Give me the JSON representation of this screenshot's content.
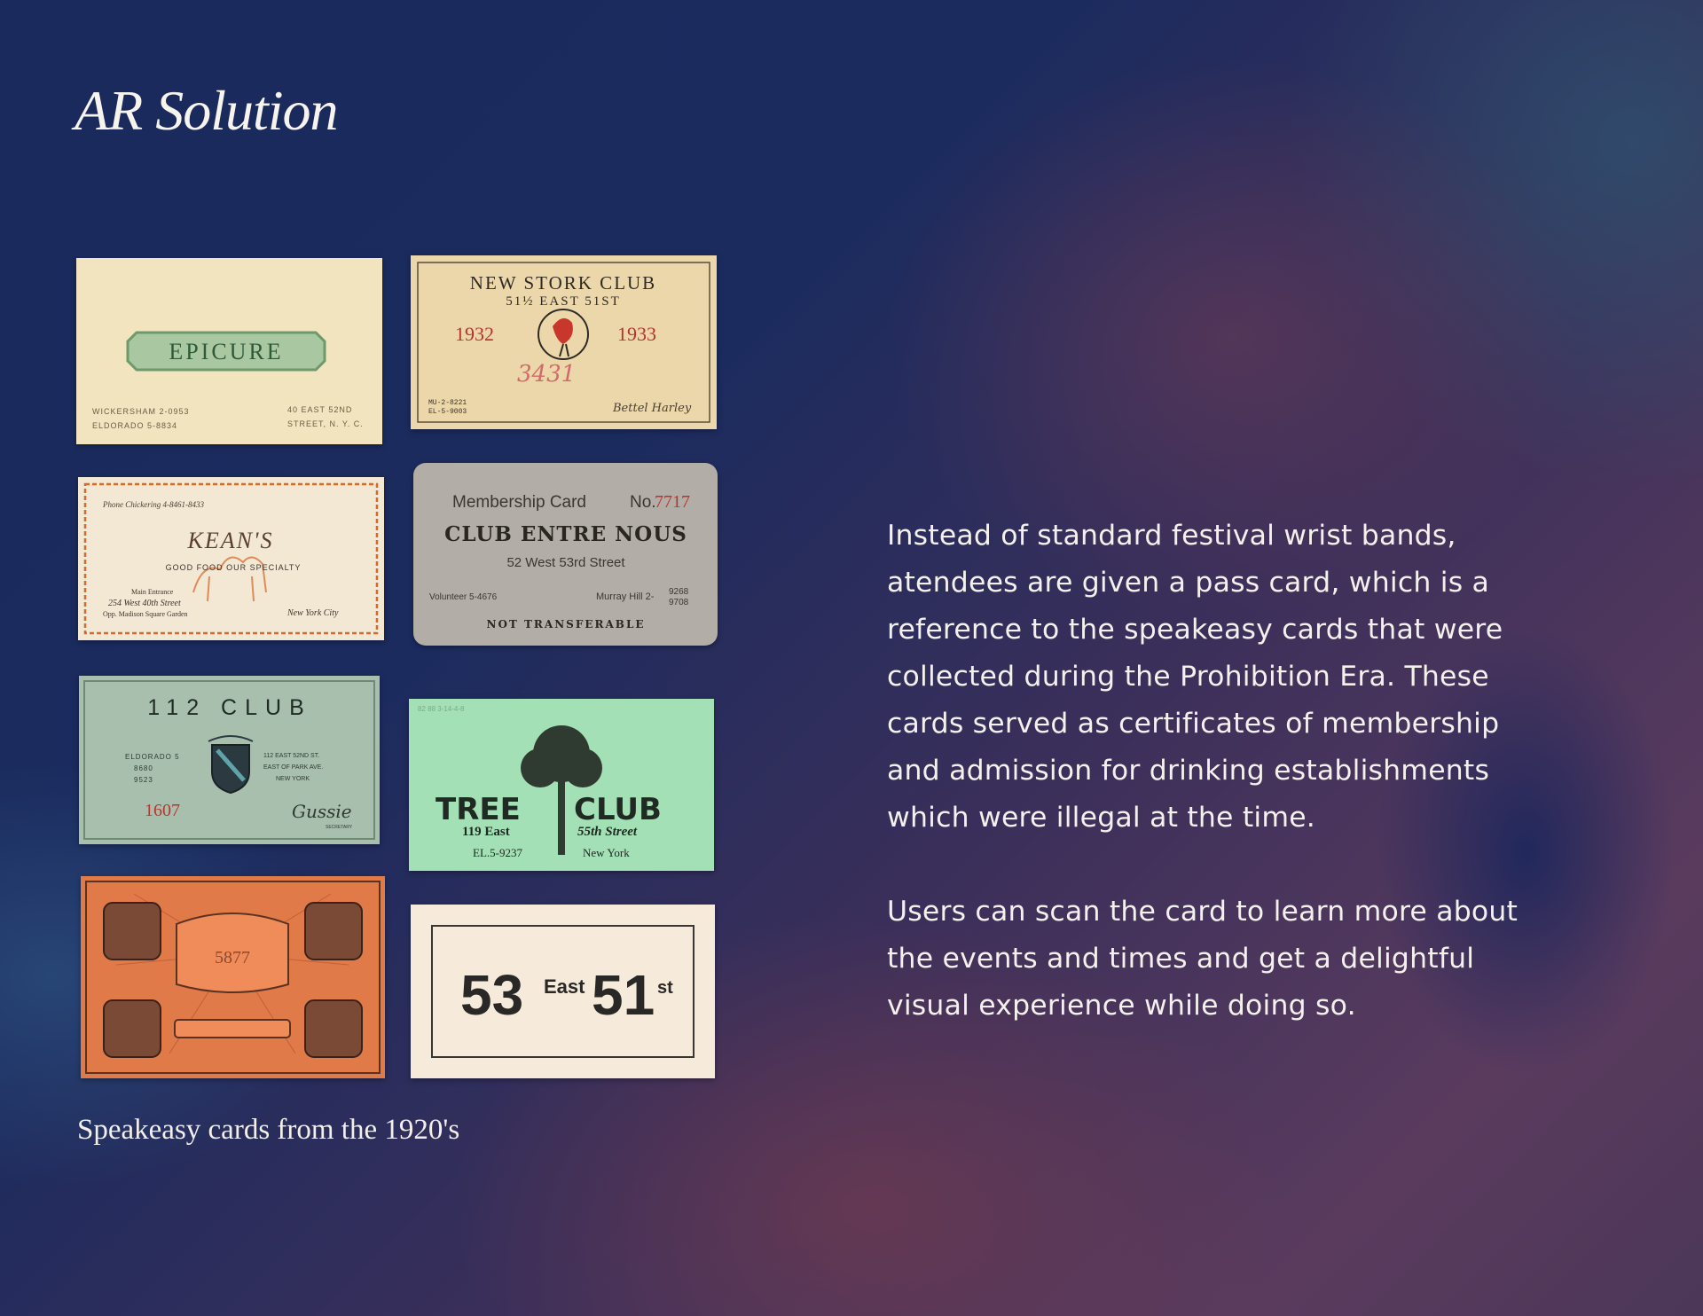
{
  "page": {
    "title": "AR Solution",
    "caption": "Speakeasy cards from the 1920's"
  },
  "description": {
    "paragraph1": [
      "Instead of standard festival wrist bands,",
      "atendees are given a pass card, which is a",
      "reference to the speakeasy cards that were",
      "collected during the Prohibition Era. These",
      "cards served as certificates of membership",
      "and admission for drinking establishments",
      "which were illegal at the time."
    ],
    "paragraph2": [
      "Users can scan the card to learn more about",
      "the events and times and get a delightful",
      "visual experience while doing so."
    ]
  },
  "cards": {
    "epicure": {
      "name": "EPICURE",
      "phone_left_1": "WICKERSHAM 2-0953",
      "phone_left_2": "ELDORADO 5-8834",
      "addr_1": "40 EAST 52ND",
      "addr_2": "STREET, N. Y. C."
    },
    "stork": {
      "name": "NEW STORK CLUB",
      "address": "51½ EAST 51ST",
      "year_left": "1932",
      "year_right": "1933",
      "number": "3431",
      "phone_1": "MU-2-8221",
      "phone_2": "EL-5-9003",
      "signature": "Bettel Harley"
    },
    "keans": {
      "phone": "Phone Chickering 4-8461-8433",
      "name": "KEAN'S",
      "tagline": "GOOD FOOD OUR SPECIALTY",
      "entrance": "Main Entrance",
      "address": "254 West 40th Street",
      "location": "Opp. Madison Square Garden",
      "city": "New York City"
    },
    "entre_nous": {
      "label": "Membership Card",
      "no_label": "No.",
      "number": "7717",
      "name": "CLUB ENTRE NOUS",
      "address": "52 West 53rd Street",
      "phone_left": "Volunteer 5-4676",
      "phone_right": "Murray Hill 2-",
      "phone_ext_1": "9268",
      "phone_ext_2": "9708",
      "note": "NOT TRANSFERABLE"
    },
    "club112": {
      "name": "112 CLUB",
      "left_1": "ELDORADO 5",
      "left_2": "8680",
      "left_3": "9523",
      "right_1": "112 EAST 52ND ST.",
      "right_2": "EAST OF PARK AVE.",
      "right_3": "NEW YORK",
      "number": "1607",
      "signature": "Gussie",
      "role": "SECRETARY"
    },
    "tree": {
      "stamp": "82 88 3-14-4-8",
      "name_left": "TREE",
      "name_right": "CLUB",
      "addr_left": "119 East",
      "addr_right": "55th Street",
      "phone": "EL.5-9237",
      "city": "New York"
    },
    "orange": {
      "number": "5877"
    },
    "east51": {
      "num1": "53",
      "word": "East",
      "num2": "51",
      "suffix": "st"
    }
  },
  "colors": {
    "background": "#1c2a5a",
    "text": "#f4f1ec",
    "epicure_card": "#f1e4bf",
    "stork_card": "#ecd7aa",
    "keans_card": "#f3e8d4",
    "entre_nous_card": "#b2ada6",
    "club112_card": "#a9bfad",
    "tree_card": "#a3e0b5",
    "orange_card": "#e07a48",
    "east51_card": "#f6eadb"
  }
}
